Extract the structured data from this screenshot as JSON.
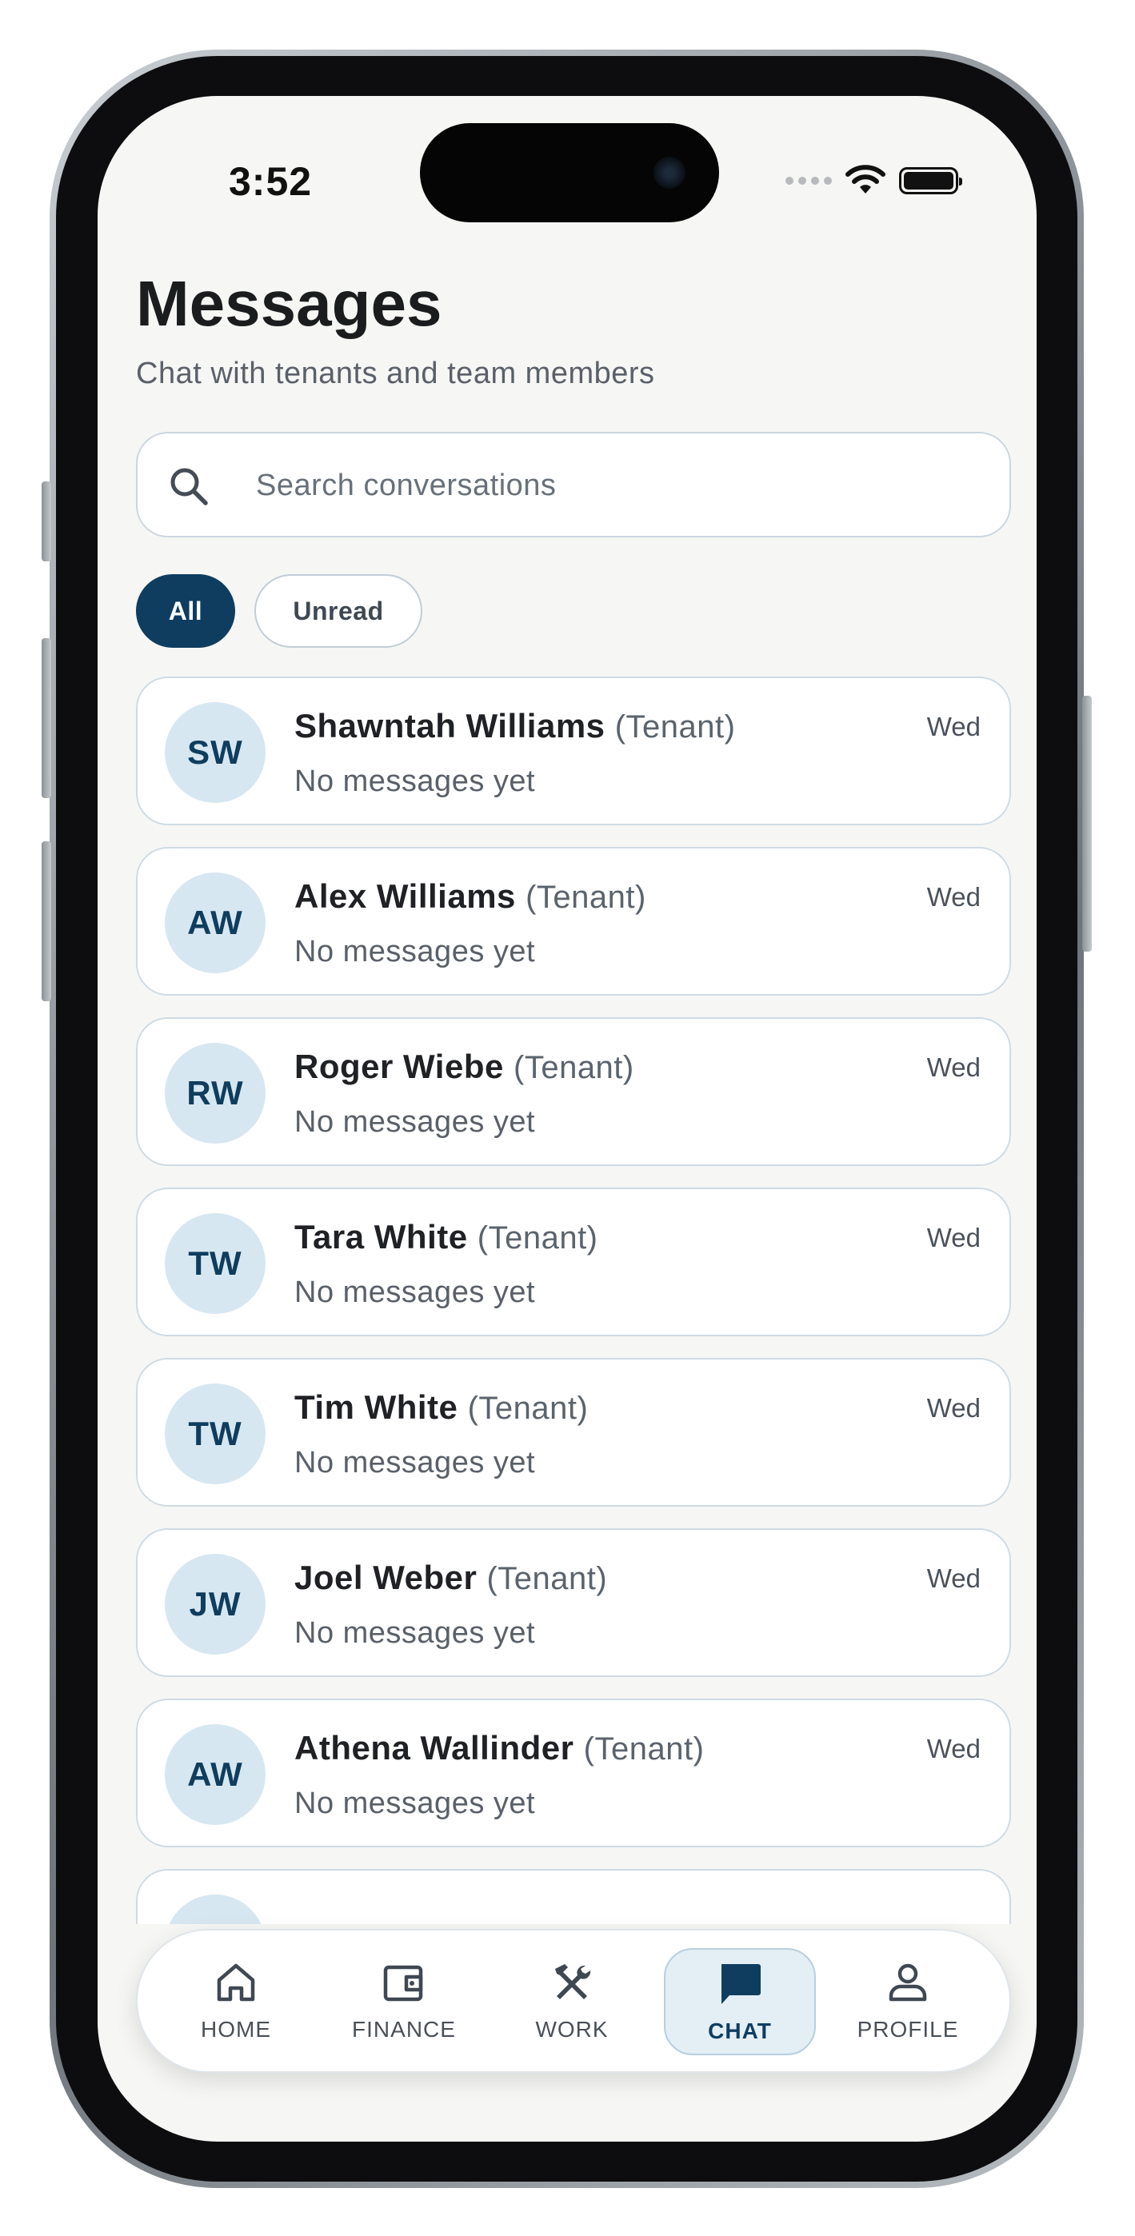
{
  "status_bar": {
    "time": "3:52"
  },
  "header": {
    "title": "Messages",
    "subtitle": "Chat with tenants and team members"
  },
  "search": {
    "placeholder": "Search conversations",
    "value": ""
  },
  "filters": {
    "all_label": "All",
    "unread_label": "Unread",
    "selected": "All"
  },
  "conversations": [
    {
      "initials": "SW",
      "name": "Shawntah Williams",
      "role": "(Tenant)",
      "preview": "No messages yet",
      "time": "Wed"
    },
    {
      "initials": "AW",
      "name": "Alex Williams",
      "role": "(Tenant)",
      "preview": "No messages yet",
      "time": "Wed"
    },
    {
      "initials": "RW",
      "name": "Roger Wiebe",
      "role": "(Tenant)",
      "preview": "No messages yet",
      "time": "Wed"
    },
    {
      "initials": "TW",
      "name": "Tara White",
      "role": "(Tenant)",
      "preview": "No messages yet",
      "time": "Wed"
    },
    {
      "initials": "TW",
      "name": "Tim White",
      "role": "(Tenant)",
      "preview": "No messages yet",
      "time": "Wed"
    },
    {
      "initials": "JW",
      "name": "Joel Weber",
      "role": "(Tenant)",
      "preview": "No messages yet",
      "time": "Wed"
    },
    {
      "initials": "AW",
      "name": "Athena Wallinder",
      "role": "(Tenant)",
      "preview": "No messages yet",
      "time": "Wed"
    }
  ],
  "tabbar": {
    "home": "HOME",
    "finance": "FINANCE",
    "work": "WORK",
    "chat": "CHAT",
    "profile": "PROFILE",
    "active": "CHAT"
  },
  "colors": {
    "brand": "#0e3d60",
    "avatar_bg": "#d7e7f1",
    "active_tab_bg": "#e3eef5"
  }
}
